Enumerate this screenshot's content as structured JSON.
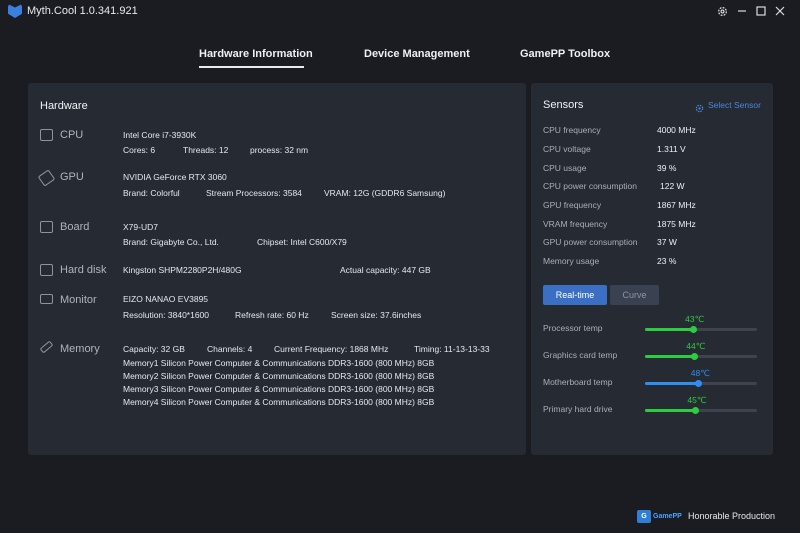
{
  "app": {
    "title": "Myth.Cool  1.0.341.921"
  },
  "nav": {
    "tabs": [
      {
        "label": "Hardware Information"
      },
      {
        "label": "Device Management"
      },
      {
        "label": "GamePP Toolbox"
      }
    ]
  },
  "hardware": {
    "title": "Hardware",
    "cpu": {
      "label": "CPU",
      "name": "Intel Core i7-3930K",
      "cores": "Cores:  6",
      "threads": "Threads:  12",
      "process": "process:  32 nm"
    },
    "gpu": {
      "label": "GPU",
      "name": "NVIDIA GeForce RTX 3060",
      "brand": "Brand:  Colorful",
      "stream": "Stream Processors:  3584",
      "vram": "VRAM:  12G (GDDR6 Samsung)"
    },
    "board": {
      "label": "Board",
      "name": "X79-UD7",
      "brand": "Brand:  Gigabyte Co., Ltd.",
      "chipset": "Chipset:  Intel C600/X79"
    },
    "disk": {
      "label": "Hard disk",
      "name": "Kingston SHPM2280P2H/480G",
      "capacity": "Actual capacity: 447 GB"
    },
    "monitor": {
      "label": "Monitor",
      "name": "EIZO NANAO EV3895",
      "resolution": "Resolution:  3840*1600",
      "refresh": "Refresh rate:  60 Hz",
      "screen": "Screen size:  37.6inches"
    },
    "memory": {
      "label": "Memory",
      "capacity": "Capacity:  32 GB",
      "channels": "Channels:  4",
      "frequency": "Current Frequency:  1868 MHz",
      "timing": "Timing:  11-13-13-33",
      "modules": [
        "Memory1  Silicon Power Computer & Communications DDR3-1600 (800 MHz) 8GB",
        "Memory2  Silicon Power Computer & Communications DDR3-1600 (800 MHz) 8GB",
        "Memory3  Silicon Power Computer & Communications DDR3-1600 (800 MHz) 8GB",
        "Memory4  Silicon Power Computer & Communications DDR3-1600 (800 MHz) 8GB"
      ]
    }
  },
  "sensors": {
    "title": "Sensors",
    "select_label": "Select Sensor",
    "rows": [
      {
        "name": "CPU frequency",
        "value": "4000 MHz"
      },
      {
        "name": "CPU voltage",
        "value": "1.311 V"
      },
      {
        "name": "CPU usage",
        "value": "39 %"
      },
      {
        "name": "CPU power consumption",
        "value": "122 W"
      },
      {
        "name": "GPU frequency",
        "value": "1867 MHz"
      },
      {
        "name": "VRAM frequency",
        "value": "1875 MHz"
      },
      {
        "name": "GPU power consumption",
        "value": "37 W"
      },
      {
        "name": "Memory usage",
        "value": "23 %"
      }
    ],
    "modes": {
      "realtime": "Real-time",
      "curve": "Curve"
    },
    "temps": [
      {
        "name": "Processor temp",
        "value": "43℃",
        "level": 0.43,
        "color": "#2ecc40"
      },
      {
        "name": "Graphics card temp",
        "value": "44℃",
        "level": 0.44,
        "color": "#2ecc40"
      },
      {
        "name": "Motherboard temp",
        "value": "48℃",
        "level": 0.48,
        "color": "#2e8ff0"
      },
      {
        "name": "Primary hard drive",
        "value": "45℃",
        "level": 0.45,
        "color": "#2ecc40"
      }
    ]
  },
  "footer": {
    "brand": "GamePP",
    "text": "Honorable Production"
  },
  "colors": {
    "background": "#1a1c22",
    "panel": "#262a33",
    "accent_blue": "#3a6fc4",
    "green": "#2ecc40"
  }
}
